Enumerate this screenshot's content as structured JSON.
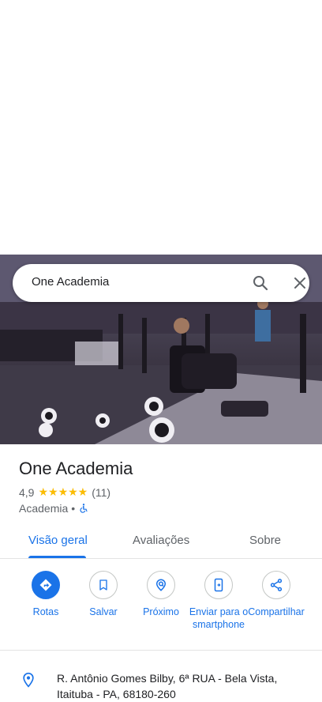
{
  "search": {
    "query": "One Academia"
  },
  "place": {
    "name": "One Academia",
    "rating": "4,9",
    "stars": "★★★★★",
    "reviews_count": "(11)",
    "category": "Academia",
    "separator": "•"
  },
  "tabs": [
    {
      "label": "Visão geral",
      "active": true
    },
    {
      "label": "Avaliações",
      "active": false
    },
    {
      "label": "Sobre",
      "active": false
    }
  ],
  "actions": [
    {
      "label": "Rotas",
      "icon": "directions-icon"
    },
    {
      "label": "Salvar",
      "icon": "bookmark-icon"
    },
    {
      "label": "Próximo",
      "icon": "nearby-icon"
    },
    {
      "label": "Enviar para o smartphone",
      "icon": "send-to-phone-icon"
    },
    {
      "label": "Compartilhar",
      "icon": "share-icon"
    }
  ],
  "address": "R. Antônio Gomes Bilby, 6ª RUA - Bela Vista, Itaituba - PA, 68180-260",
  "colors": {
    "accent": "#1a73e8",
    "star": "#fbbc04"
  }
}
